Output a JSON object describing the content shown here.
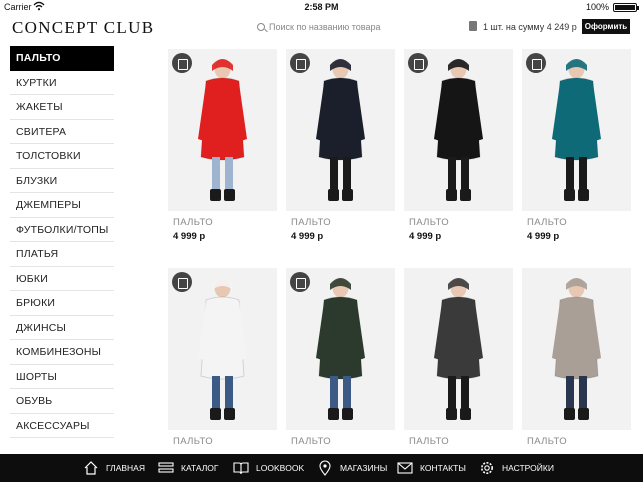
{
  "status_bar": {
    "carrier": "Carrier",
    "time": "2:58 PM",
    "battery": "100%"
  },
  "header": {
    "logo": "CONCEPT CLUB",
    "search_placeholder": "Поиск по названию товара",
    "cart_summary": "1 шт. на сумму 4 249 р",
    "checkout_label": "Оформить"
  },
  "sidebar": {
    "items": [
      {
        "label": "ПАЛЬТО",
        "active": true
      },
      {
        "label": "КУРТКИ"
      },
      {
        "label": "ЖАКЕТЫ"
      },
      {
        "label": "СВИТЕРА"
      },
      {
        "label": "ТОЛСТОВКИ"
      },
      {
        "label": "БЛУЗКИ"
      },
      {
        "label": "ДЖЕМПЕРЫ"
      },
      {
        "label": "ФУТБОЛКИ/ТОПЫ"
      },
      {
        "label": "ПЛАТЬЯ"
      },
      {
        "label": "ЮБКИ"
      },
      {
        "label": "БРЮКИ"
      },
      {
        "label": "ДЖИНСЫ"
      },
      {
        "label": "КОМБИНЕЗОНЫ"
      },
      {
        "label": "ШОРТЫ"
      },
      {
        "label": "ОБУВЬ"
      },
      {
        "label": "АКСЕССУАРЫ"
      }
    ]
  },
  "products": [
    {
      "title": "ПАЛЬТО",
      "price": "4 999 р",
      "coat_color": "#e0201f",
      "pants_color": "#9fb4cf",
      "bag": true
    },
    {
      "title": "ПАЛЬТО",
      "price": "4 999 р",
      "coat_color": "#1b1e2b",
      "pants_color": "#1a1a1a",
      "bag": true
    },
    {
      "title": "ПАЛЬТО",
      "price": "4 999 р",
      "coat_color": "#151515",
      "pants_color": "#1a1a1a",
      "bag": true
    },
    {
      "title": "ПАЛЬТО",
      "price": "4 999 р",
      "coat_color": "#0f6a78",
      "pants_color": "#1a1a1a",
      "bag": true
    },
    {
      "title": "ПАЛЬТО",
      "price": "",
      "coat_color": "#f4f4f4",
      "pants_color": "#3b5a86",
      "bag": true
    },
    {
      "title": "ПАЛЬТО",
      "price": "",
      "coat_color": "#2c3a2e",
      "pants_color": "#3d5a86",
      "bag": true
    },
    {
      "title": "ПАЛЬТО",
      "price": "",
      "coat_color": "#3a3a3a",
      "pants_color": "#1a1a1a",
      "bag": false
    },
    {
      "title": "ПАЛЬТО",
      "price": "",
      "coat_color": "#a99f96",
      "pants_color": "#2a3550",
      "bag": false
    }
  ],
  "tabbar": {
    "items": [
      {
        "label": "ГЛАВНАЯ",
        "icon": "home-icon"
      },
      {
        "label": "КАТАЛОГ",
        "icon": "catalog-icon"
      },
      {
        "label": "LOOKBOOK",
        "icon": "book-icon"
      },
      {
        "label": "МАГАЗИНЫ",
        "icon": "map-pin-icon"
      },
      {
        "label": "КОНТАКТЫ",
        "icon": "envelope-icon"
      },
      {
        "label": "НАСТРОЙКИ",
        "icon": "gear-icon"
      }
    ]
  }
}
